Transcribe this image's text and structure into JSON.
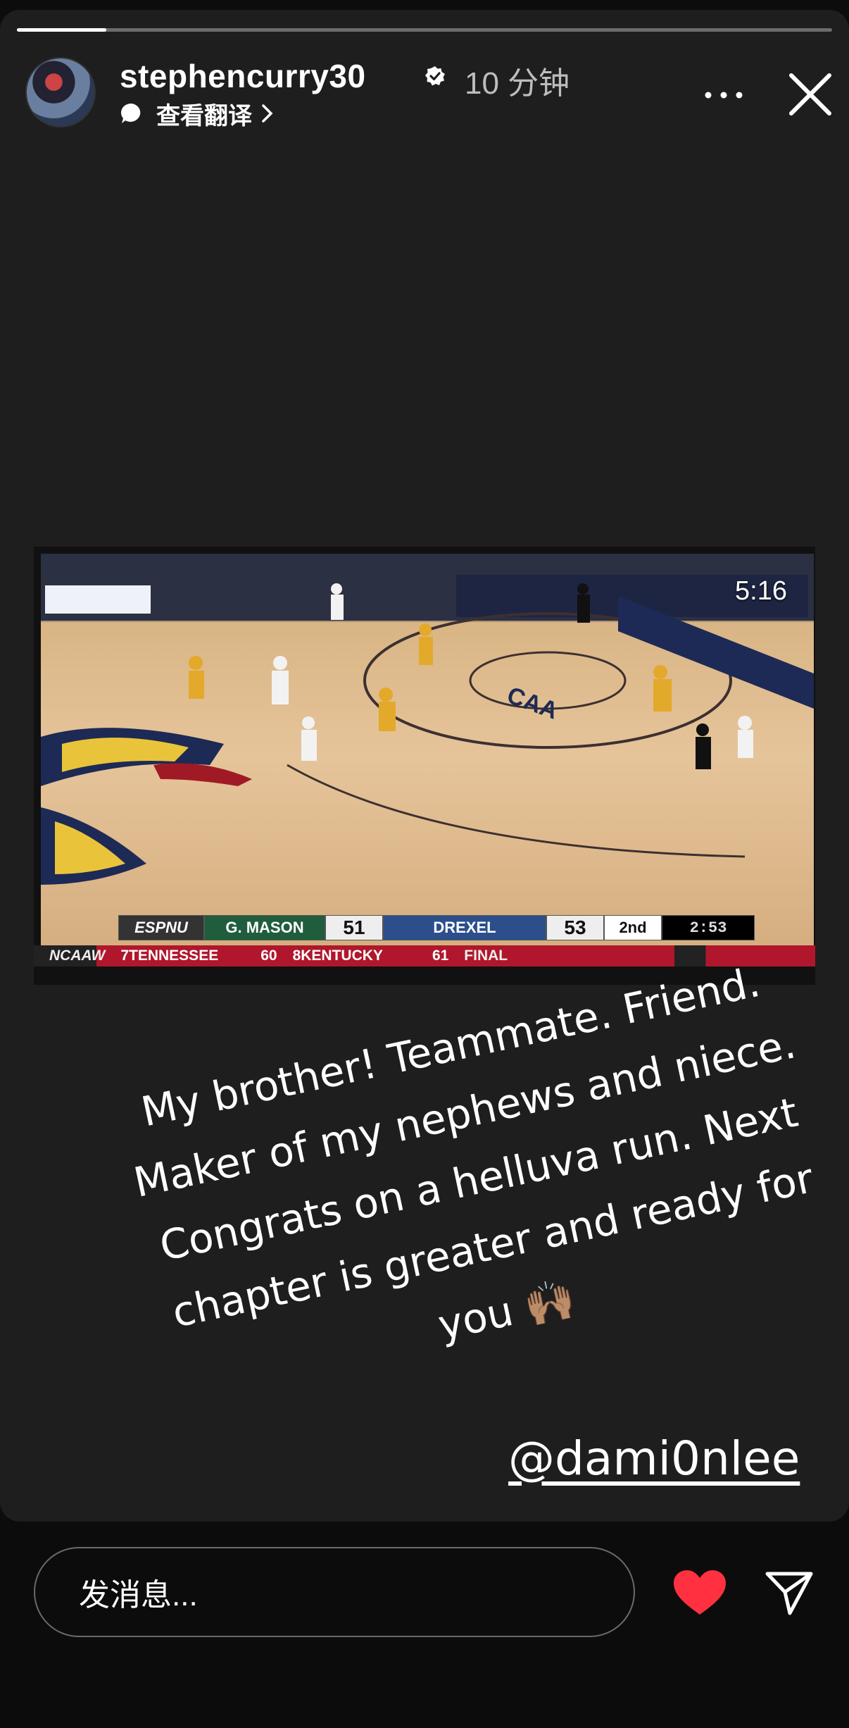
{
  "story": {
    "progress": 0.11,
    "user": {
      "username": "stephencurry30",
      "verified": true,
      "time_ago": "10 分钟",
      "translate_label": "查看翻译"
    },
    "video": {
      "duration": "5:16",
      "scoreboard": {
        "network": "ESPNU",
        "team1": "G. MASON",
        "score1": "51",
        "team2": "DREXEL",
        "score2": "53",
        "period": "2nd",
        "clock": "2:53"
      },
      "ticker": {
        "league": "NCAAW",
        "game1_team1": "7TENNESSEE",
        "game1_score1": "60",
        "game1_team2": "8KENTUCKY",
        "game1_score2": "61",
        "status": "FINAL"
      }
    },
    "caption_lines": [
      "My brother! Teammate. Friend.",
      "Maker of my nephews and niece.",
      "Congrats on a helluva run. Next",
      "chapter is greater and ready for",
      "you 🙌🏽"
    ],
    "mention": "@dami0nlee"
  },
  "footer": {
    "message_placeholder": "发消息...",
    "heart_color": "#ff3040"
  }
}
